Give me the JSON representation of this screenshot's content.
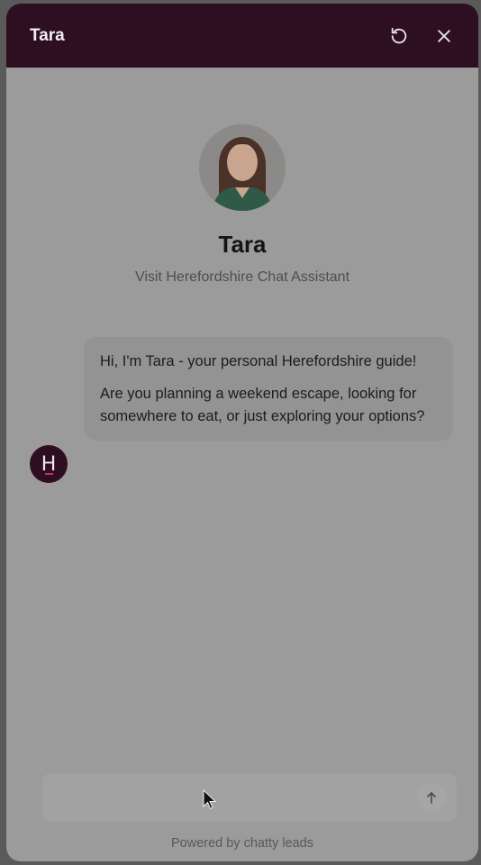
{
  "header": {
    "title": "Tara",
    "icons": [
      "refresh-icon",
      "close-icon"
    ]
  },
  "profile": {
    "name": "Tara",
    "subtitle": "Visit Herefordshire Chat Assistant"
  },
  "messages": [
    {
      "sender": "bot",
      "avatar_letter": "H",
      "paragraphs": [
        "Hi, I'm Tara - your personal Herefordshire guide!",
        "Are you planning a weekend escape, looking for somewhere to eat, or just exploring your options?"
      ]
    }
  ],
  "composer": {
    "value": "",
    "placeholder": "",
    "send_icon": "arrow-up-icon"
  },
  "footer": {
    "text": "Powered by chatty leads"
  },
  "colors": {
    "header_bg": "#2e0f22",
    "accent": "#c2306a",
    "overlay": "#9b9b9b"
  }
}
